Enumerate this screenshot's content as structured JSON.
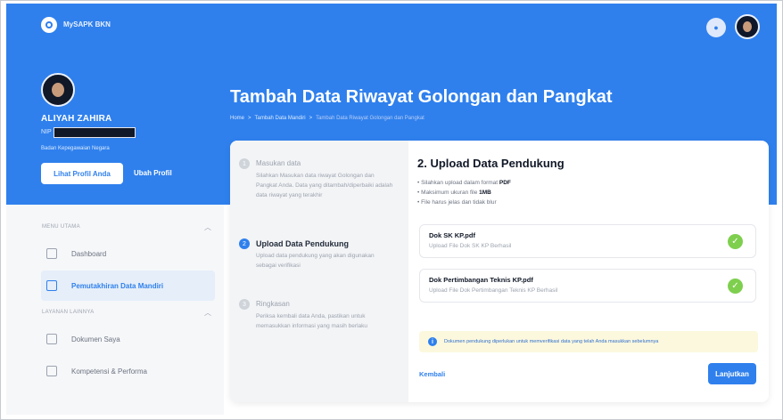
{
  "app": {
    "title": "MySAPK BKN"
  },
  "profile": {
    "name": "ALIYAH ZAHIRA",
    "nip_label": "NIP",
    "institution": "Badan Kepegawaian Negara",
    "view_profile_label": "Lihat Profil Anda",
    "edit_profile_label": "Ubah Profil"
  },
  "sidebar": {
    "sections": [
      {
        "label": "MENU UTAMA",
        "items": [
          {
            "label": "Dashboard",
            "icon": "dashboard-icon"
          },
          {
            "label": "Pemutakhiran Data Mandiri",
            "icon": "data-update-icon",
            "active": true
          }
        ]
      },
      {
        "label": "LAYANAN LAINNYA",
        "items": [
          {
            "label": "Dokumen Saya",
            "icon": "document-icon"
          },
          {
            "label": "Kompetensi & Performa",
            "icon": "performance-icon"
          }
        ]
      }
    ]
  },
  "page": {
    "title": "Tambah Data Riwayat Golongan dan Pangkat",
    "breadcrumb": [
      "Home",
      ">",
      "Tambah Data Mandiri",
      ">",
      "Tambah Data Riwayat Golongan dan Pangkat"
    ]
  },
  "steps": [
    {
      "number": "1",
      "title": "Masukan data",
      "desc": "Silahkan Masukan data riwayat Golongan dan Pangkat Anda. Data yang ditambah/diperbaiki adalah data riwayat yang terakhir"
    },
    {
      "number": "2",
      "title": "Upload Data Pendukung",
      "desc": "Upload data pendukung yang akan digunakan sebagai verifikasi"
    },
    {
      "number": "3",
      "title": "Ringkasan",
      "desc": "Periksa kembali data Anda, pastikan untuk memasukkan informasi yang masih berlaku"
    }
  ],
  "upload": {
    "title": "2. Upload Data Pendukung",
    "requirements": [
      {
        "text": "Silahkan upload dalam format ",
        "strong": "PDF"
      },
      {
        "text": "Maksimum ukuran file ",
        "strong": "1MB"
      },
      {
        "text": "File harus jelas dan tidak blur",
        "strong": ""
      }
    ],
    "files": [
      {
        "name": "Dok SK KP.pdf",
        "sub": "Upload File Dok SK KP Berhasil"
      },
      {
        "name": "Dok Pertimbangan Teknis KP.pdf",
        "sub": "Upload File Dok Pertimbangan Teknis KP Berhasil"
      }
    ],
    "info": "Dokumen pendukung diperlukan untuk memverifikasi data yang telah Anda masukkan sebelumnya",
    "back_label": "Kembali",
    "next_label": "Lanjutkan"
  },
  "colors": {
    "primary": "#2f80ed",
    "success": "#7fcf4f",
    "info_bg": "#fcf8dd"
  }
}
